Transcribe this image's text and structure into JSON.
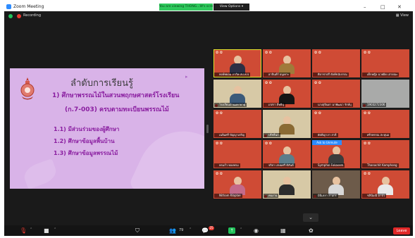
{
  "window": {
    "title": "Zoom Meeting",
    "viewing_banner": "You are viewing THONG...W's screen",
    "view_options": "View Options",
    "controls": {
      "minimize": "–",
      "maximize": "□",
      "close": "✕"
    }
  },
  "topbar": {
    "recording": "Recording",
    "view": "View"
  },
  "slide": {
    "title": "ลำดับการเรียนรู้",
    "line1": "1) ศึกษาพรรณไม้ในสวนพฤกษศาสตร์โรงเรียน",
    "line2": "(ก.7-003) ครบตามทะเบียนพรรณไม้",
    "items": [
      "1.1) มีส่วนร่วมของผู้ศึกษา",
      "1.2) ศึกษาข้อมูลพื้นบ้าน",
      "1.3) ศึกษาข้อมูลพรรณไม้"
    ]
  },
  "participants": [
    {
      "name": "พงษ์พยอม ภากิพ สป.พ.จ"
    },
    {
      "name": "อาจินต์ร์ อนุเคาะ"
    },
    {
      "name": "ศิลาชาตรี ยัลพ์ขนับรรณ"
    },
    {
      "name": "เด็กหญิง ฉวยผิด เล่ายณะ"
    },
    {
      "name": "โรงเรียนบ้านมหาธาตุ"
    },
    {
      "name": "เกสรา สิทธิบุ"
    },
    {
      "name": "นางสุจินดา มาพัฒนา รักษ์บุ"
    },
    {
      "name": "1903272306"
    },
    {
      "name": "เฉลิมศรี ปัญญาเจริญ"
    },
    {
      "name": "ปรีชรีนก"
    },
    {
      "name": "ยัตติญาภา สาลี"
    },
    {
      "name": "ศรีรพรรณ สะหุนอ"
    },
    {
      "name": "พรแก้ว ทองพรม"
    },
    {
      "name": "จริยา เกษมศรี ดิสันต์"
    },
    {
      "name": "Symphol Fokasem"
    },
    {
      "name": "Thanachit Kamphong"
    },
    {
      "name": "Nitham Kloplae"
    },
    {
      "name": "คนงาน"
    },
    {
      "name": "มินิเลลา งานกร"
    },
    {
      "name": "ชลินีมณี มาบัว"
    }
  ],
  "ask_to_unmute": "Ask to Unmute",
  "bottombar": {
    "participants_count": "79",
    "chat_badge": "25",
    "leave": "Leave"
  }
}
